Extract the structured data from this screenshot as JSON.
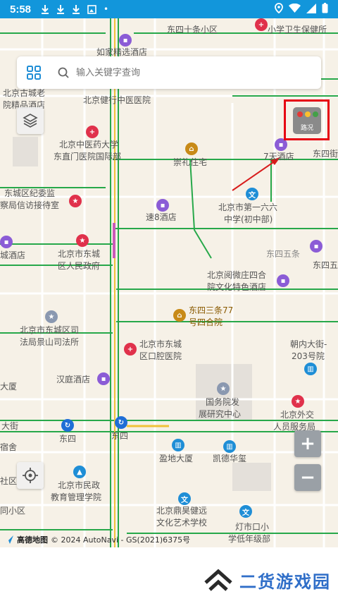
{
  "status_bar": {
    "time": "5:58",
    "dot": "•"
  },
  "search": {
    "placeholder": "输入关键字查询"
  },
  "traffic": {
    "label": "路况"
  },
  "zoom": {
    "in": "+",
    "out": "−"
  },
  "attribution": {
    "logo": "高德地图",
    "text": "© 2024 AutoNavi - GS(2021)6375号"
  },
  "watermark": {
    "text": "二货游戏园"
  },
  "map_labels": {
    "l1": "东四十条小区",
    "l2": "小学卫生保健所",
    "l3": "如家精选酒店",
    "l4": "北京古城老",
    "l5": "院精品酒店",
    "l6": "北京健行中医医院",
    "l7": "北京中医药大学",
    "l8": "东直门医院国际部",
    "l9": "崇礼住宅",
    "l10": "7天酒店",
    "l11": "东四街",
    "l12": "东城区纪委监",
    "l13": "察局信访接待室",
    "l14": "速8酒店",
    "l15": "北京市第一六六",
    "l16": "中学(初中部)",
    "l17": "北京市东城",
    "l18": "区人民政府",
    "l19": "城酒店",
    "l20": "东四五条",
    "l21": "东四五",
    "l22": "北京阅微庄四合",
    "l23": "院文化特色酒店",
    "l24": "东四三条77",
    "l25": "号四合院",
    "l26": "北京市东城区司",
    "l27": "法局景山司法所",
    "l28": "北京市东城",
    "l29": "区口腔医院",
    "l30": "朝内大街-",
    "l31": "203号院",
    "l32": "汉庭酒店",
    "l33": "国务院发",
    "l34": "展研究中心",
    "l35": "北京外交",
    "l36": "人员服务局",
    "l37": "东四",
    "l38": "东四",
    "l39": "盈地大厦",
    "l40": "凯德华玺",
    "l41": "北京市民政",
    "l42": "教育管理学院",
    "l43": "北京鼎昊健远",
    "l44": "文化艺术学校",
    "l45": "灯市口小",
    "l46": "学低年级部",
    "l47": "大街",
    "l48": "宿舍",
    "l49": "社区",
    "l50": "同小区",
    "l51": "大厦"
  }
}
